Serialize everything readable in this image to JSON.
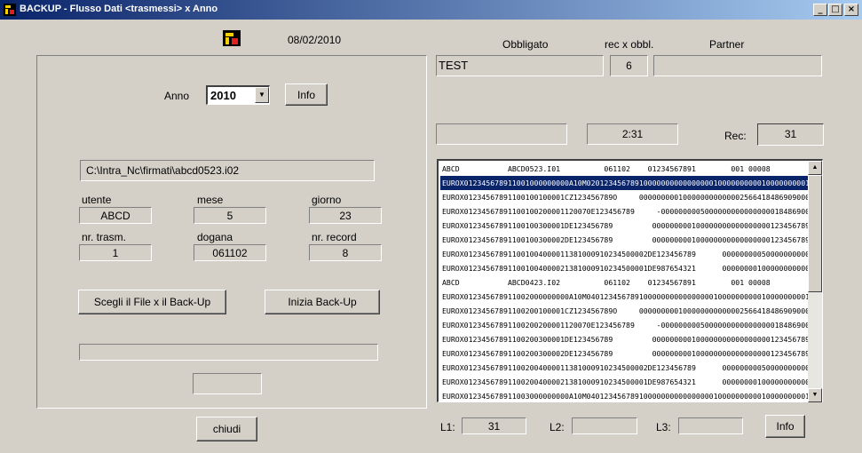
{
  "window": {
    "title": "BACKUP - Flusso Dati <trasmessi> x Anno",
    "minimize_glyph": "_",
    "maximize_glyph": "□",
    "close_glyph": "×"
  },
  "header": {
    "date": "08/02/2010"
  },
  "left_panel": {
    "anno_label": "Anno",
    "anno_value": "2010",
    "info_button": "Info",
    "file_path": "C:\\Intra_Nc\\firmati\\abcd0523.i02",
    "fields": {
      "utente_label": "utente",
      "utente_value": "ABCD",
      "mese_label": "mese",
      "mese_value": "5",
      "giorno_label": "giorno",
      "giorno_value": "23",
      "trasm_label": "nr. trasm.",
      "trasm_value": "1",
      "dogana_label": "dogana",
      "dogana_value": "061102",
      "record_label": "nr. record",
      "record_value": "8"
    },
    "choose_file_button": "Scegli il File x il Back-Up",
    "start_backup_button": "Inizia Back-Up",
    "progress": 0
  },
  "close_button": "chiudi",
  "right_panel": {
    "obbligato_label": "Obbligato",
    "rec_obbl_label": "rec x obbl.",
    "partner_label": "Partner",
    "obbligato_value": "TEST",
    "rec_obbl_value": "6",
    "partner_value": "",
    "field_a_value": "",
    "time_value": "2:31",
    "rec_label": "Rec:",
    "rec_value": "31",
    "list_rows": [
      "ABCD           ABCD0523.I01          061102    01234567891        001 00008",
      "EUROX012345678911001000000000A10M0201234567891000000000000000010000000000100000000010000000000",
      "EUROX01234567891100100100001CZ123456789O     00000000010000000000000256641848690900000000",
      "EUROX01234567891100100200001120070E123456789     -000000000500000000000000001848690000",
      "EUROX01234567891100100300001DE123456789         0000000001000000000000000001234567890123",
      "EUROX01234567891100100300002DE123456789         0000000001000000000000000001234567890123",
      "EUROX012345678911001004000011381000910234500002DE123456789      00000000050000000000000000",
      "EUROX012345678911001004000021381000910234500001DE987654321      00000000100000000000000000",
      "ABCD           ABCD0423.I02          061102    01234567891        001 00008",
      "EUROX012345678911002000000000A10M0401234567891000000000000000010000000000100000000010000000000",
      "EUROX01234567891100200100001CZ123456789O     00000000010000000000000256641848690900000000",
      "EUROX01234567891100200200001120070E123456789     -000000000500000000000000001848690000",
      "EUROX01234567891100200300001DE123456789         0000000001000000000000000001234567890123",
      "EUROX01234567891100200300002DE123456789         0000000001000000000000000001234567890123",
      "EUROX012345678911002004000011381000910234500002DE123456789      00000000050000000000000000",
      "EUROX012345678911002004000021381000910234500001DE987654321      00000000100000000000000000",
      "EUROX012345678911003000000000A10M0401234567891000000000000000010000000000100000000010000000000"
    ],
    "selected_row": 1,
    "l1_label": "L1:",
    "l1_value": "31",
    "l2_label": "L2:",
    "l2_value": "",
    "l3_label": "L3:",
    "l3_value": "",
    "info_button": "Info"
  }
}
